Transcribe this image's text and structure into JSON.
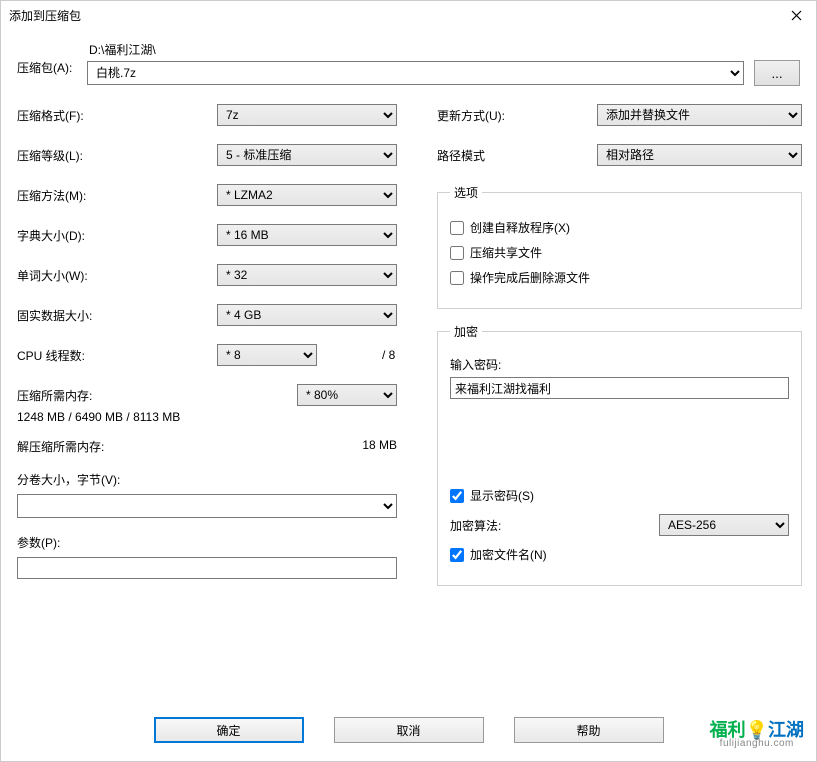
{
  "title": "添加到压缩包",
  "archive": {
    "label": "压缩包(A):",
    "path": "D:\\福利江湖\\",
    "name": "白桃.7z",
    "browse": "..."
  },
  "left": {
    "format": {
      "label": "压缩格式(F):",
      "value": "7z"
    },
    "level": {
      "label": "压缩等级(L):",
      "value": "5 - 标准压缩"
    },
    "method": {
      "label": "压缩方法(M):",
      "value": "* LZMA2"
    },
    "dict": {
      "label": "字典大小(D):",
      "value": "* 16 MB"
    },
    "word": {
      "label": "单词大小(W):",
      "value": "* 32"
    },
    "solid": {
      "label": "固实数据大小:",
      "value": "* 4 GB"
    },
    "threads": {
      "label": "CPU 线程数:",
      "value": "* 8",
      "total": "/ 8"
    },
    "memcomp": {
      "label": "压缩所需内存:",
      "pct": "* 80%",
      "info": "1248 MB / 6490 MB / 8113 MB"
    },
    "memdecomp": {
      "label": "解压缩所需内存:",
      "value": "18 MB"
    },
    "volsize": {
      "label": "分卷大小，字节(V):"
    },
    "params": {
      "label": "参数(P):"
    }
  },
  "right": {
    "update": {
      "label": "更新方式(U):",
      "value": "添加并替换文件"
    },
    "pathmode": {
      "label": "路径模式",
      "value": "相对路径"
    },
    "options": {
      "legend": "选项",
      "sfx": "创建自释放程序(X)",
      "shared": "压缩共享文件",
      "delete": "操作完成后删除源文件"
    },
    "enc": {
      "legend": "加密",
      "pwdlabel": "输入密码:",
      "pwd": "来福利江湖找福利",
      "showpwd": "显示密码(S)",
      "alglabel": "加密算法:",
      "alg": "AES-256",
      "encnames": "加密文件名(N)"
    }
  },
  "buttons": {
    "ok": "确定",
    "cancel": "取消",
    "help": "帮助"
  },
  "watermark": {
    "p1": "福利",
    "p2": "江湖",
    "sub": "fulijianghu.com"
  }
}
